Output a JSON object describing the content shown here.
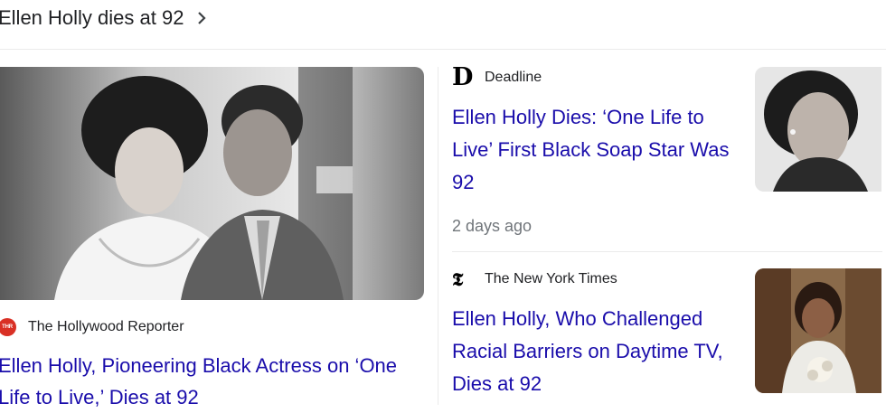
{
  "header": {
    "title": "Ellen Holly dies at 92"
  },
  "icons": {
    "chevron": "chevron-right-icon",
    "thr_favicon": "thr-logo",
    "deadline_favicon": "deadline-d-logo",
    "nyt_favicon": "nyt-t-logo"
  },
  "colors": {
    "link": "#1a0dab",
    "meta": "#70757a",
    "thr_red": "#d93025"
  },
  "left_story": {
    "favicon_text": "THR",
    "source": "The Hollywood Reporter",
    "headline": "Ellen Holly, Pioneering Black Actress on ‘One Life to Live,’ Dies at 92"
  },
  "stories": [
    {
      "favicon_text": "D",
      "source": "Deadline",
      "headline": "Ellen Holly Dies: ‘One Life to Live’ First Black Soap Star Was 92",
      "time": "2 days ago"
    },
    {
      "favicon_text": "𝕿",
      "source": "The New York Times",
      "headline": "Ellen Holly, Who Challenged Racial Barriers on Daytime TV, Dies at 92"
    }
  ]
}
